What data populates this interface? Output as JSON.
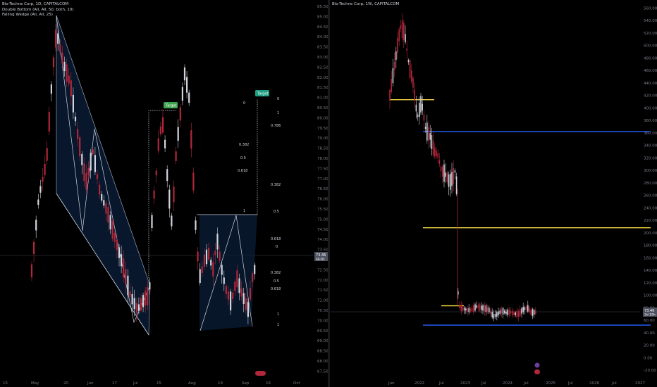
{
  "left_chart": {
    "legend": {
      "symbol": "Bio-Techne Corp, 1D, CAPITALCOM",
      "indicator1": "Double Bottom (All, All, 50, both, 10)",
      "indicator2": "Falling Wedge (All, All, 25)"
    },
    "price_axis": [
      "85.50",
      "85.00",
      "84.50",
      "84.00",
      "83.50",
      "83.00",
      "82.50",
      "82.00",
      "81.50",
      "81.00",
      "80.50",
      "80.00",
      "79.50",
      "79.00",
      "78.50",
      "78.00",
      "77.50",
      "77.00",
      "76.50",
      "76.00",
      "75.50",
      "75.00",
      "74.50",
      "74.00",
      "73.50",
      "73.00",
      "72.50",
      "72.00",
      "71.50",
      "71.00",
      "70.50",
      "70.00",
      "69.50",
      "69.00",
      "68.50",
      "68.00",
      "67.50"
    ],
    "time_axis": [
      "15",
      "May",
      "20",
      "Jun",
      "17",
      "Jul",
      "15",
      "Aug",
      "19",
      "Sep",
      "16",
      "Oct"
    ],
    "price_badge": {
      "price": "73.46",
      "countdown": "46:01"
    },
    "targets": [
      "Target",
      "Target"
    ],
    "fib_left": [
      "0",
      "0.382",
      "0.5",
      "0.618"
    ],
    "fib_right": [
      "0",
      "1",
      "0.786",
      "0.382",
      "0.5",
      "0.618",
      "0",
      "0.382",
      "0.5",
      "0.618",
      "1",
      "1",
      "1"
    ]
  },
  "right_chart": {
    "legend": {
      "symbol": "Bio-Techne Corp, 1W, CAPITALCOM"
    },
    "price_axis": [
      "560.00",
      "540.00",
      "520.00",
      "500.00",
      "480.00",
      "460.00",
      "440.00",
      "420.00",
      "400.00",
      "380.00",
      "360.00",
      "340.00",
      "320.00",
      "300.00",
      "280.00",
      "260.00",
      "240.00",
      "220.00",
      "200.00",
      "180.00",
      "160.00",
      "140.00",
      "120.00",
      "100.00",
      "80.00",
      "60.00",
      "40.00",
      "20.00",
      "0.00",
      "-20.00"
    ],
    "time_axis": [
      "Jun",
      "2022",
      "Jul",
      "2023",
      "Jul",
      "2024",
      "Jul",
      "2025",
      "Jul",
      "2026",
      "Jul",
      "2027"
    ],
    "price_badge": {
      "price": "73.46",
      "countdown": "3d 19h"
    },
    "levels": [
      {
        "price": 413,
        "color": "#f5d742"
      },
      {
        "price": 362,
        "color": "#2962ff"
      },
      {
        "price": 208,
        "color": "#f5d742"
      },
      {
        "price": 83,
        "color": "#f5d742"
      },
      {
        "price": 52,
        "color": "#2962ff"
      }
    ]
  },
  "colors": {
    "up": "#d1d4dc",
    "down": "#b2263a",
    "wedge": "#0b1f3a"
  }
}
